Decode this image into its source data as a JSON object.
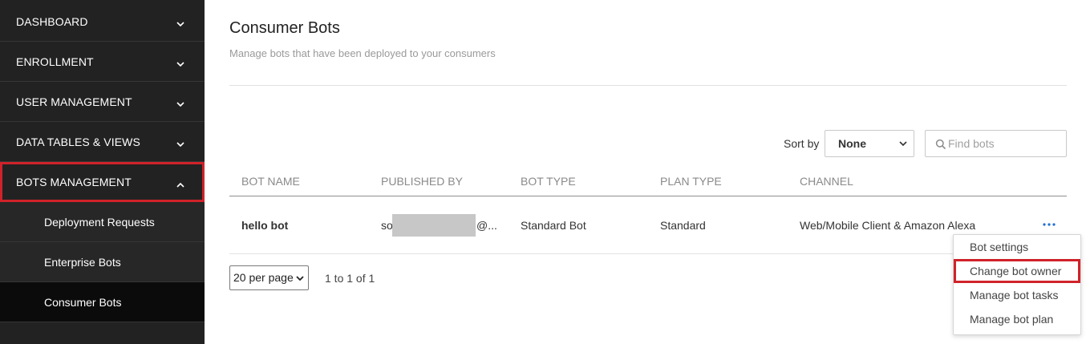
{
  "sidebar": {
    "items": [
      {
        "label": "DASHBOARD"
      },
      {
        "label": "ENROLLMENT"
      },
      {
        "label": "USER MANAGEMENT"
      },
      {
        "label": "DATA TABLES & VIEWS"
      },
      {
        "label": "BOTS MANAGEMENT"
      }
    ],
    "sub_items": [
      {
        "label": "Deployment Requests"
      },
      {
        "label": "Enterprise Bots"
      },
      {
        "label": "Consumer Bots",
        "active": true
      }
    ]
  },
  "page": {
    "title": "Consumer Bots",
    "subtitle": "Manage bots that have been deployed to your consumers"
  },
  "toolbar": {
    "sort_label": "Sort by",
    "sort_value": "None",
    "search_placeholder": "Find bots"
  },
  "table": {
    "columns": [
      "BOT NAME",
      "PUBLISHED BY",
      "BOT TYPE",
      "PLAN TYPE",
      "CHANNEL"
    ],
    "rows": [
      {
        "bot_name": "hello bot",
        "published_by_prefix": "so",
        "published_by_suffix": "@...",
        "bot_type": "Standard Bot",
        "plan_type": "Standard",
        "channel": "Web/Mobile Client & Amazon Alexa"
      }
    ]
  },
  "pagination": {
    "per_page": "20 per page",
    "range": "1 to 1 of 1"
  },
  "row_menu": {
    "items": [
      {
        "label": "Bot settings"
      },
      {
        "label": "Change bot owner"
      },
      {
        "label": "Manage bot tasks"
      },
      {
        "label": "Manage bot plan"
      }
    ]
  },
  "colors": {
    "sidebar_bg": "#222222",
    "active_sub_bg": "#0b0b0b",
    "highlight": "#d0222a",
    "more_icon": "#1f6fd1"
  },
  "icons": {
    "chevron_down": "chevron-down-icon",
    "chevron_up": "chevron-up-icon",
    "search": "search-icon",
    "more": "more-horizontal-icon"
  }
}
